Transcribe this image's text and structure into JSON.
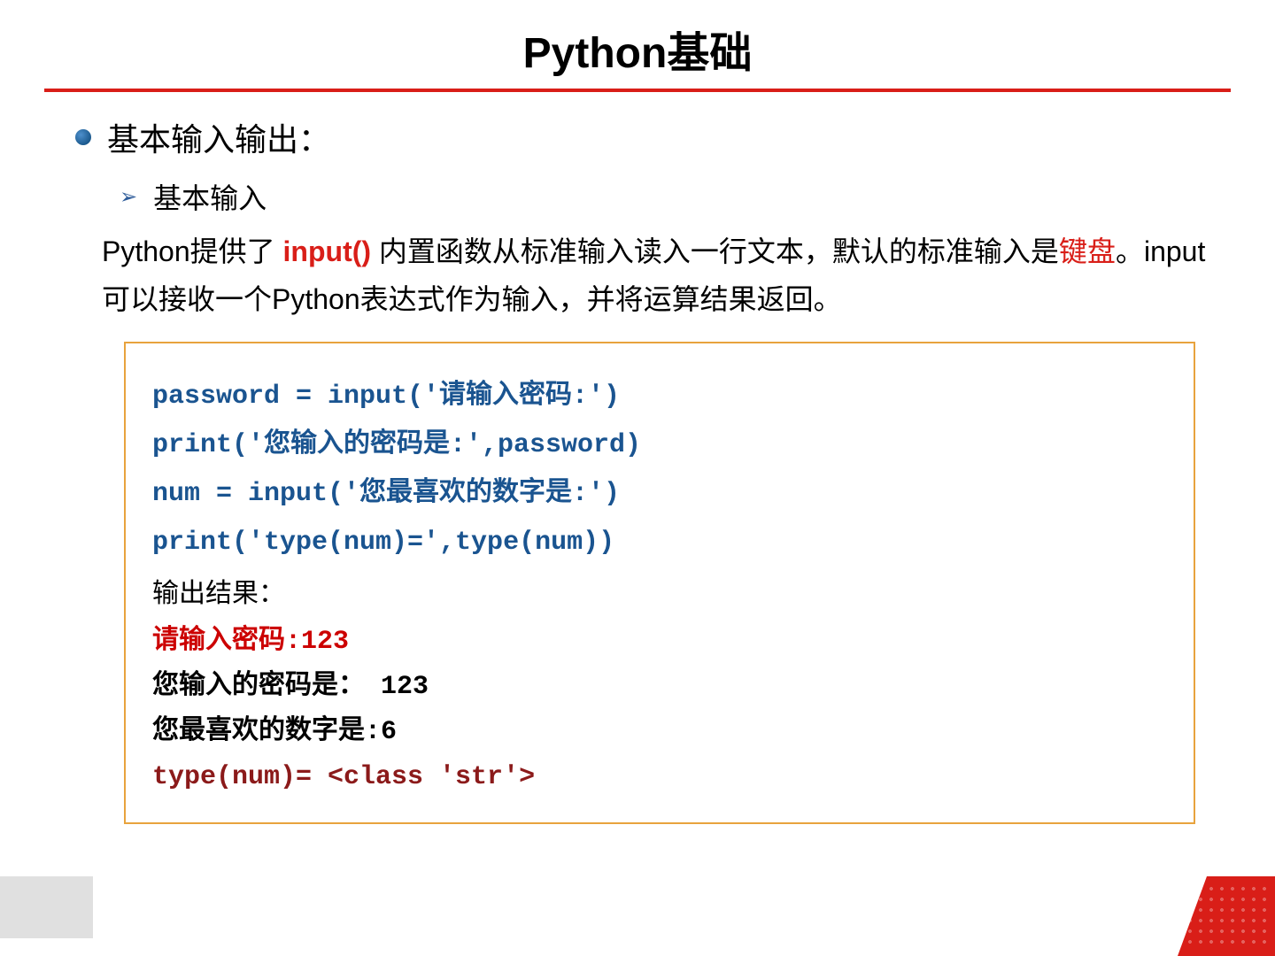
{
  "title": "Python基础",
  "section_heading": "基本输入输出：",
  "sub_heading": "基本输入",
  "paragraph": {
    "prefix": "Python提供了 ",
    "func": "input()",
    "mid1": " 内置函数从标准输入读入一行文本，默认的标准输入是",
    "keyboard": "键盘",
    "mid2": "。input 可以接收一个Python表达式作为输入，并将运算结果返回。"
  },
  "code": {
    "line1": "password = input('请输入密码:')",
    "line2": "print('您输入的密码是:',password)",
    "line3": "num = input('您最喜欢的数字是:')",
    "line4": "print('type(num)=',type(num))",
    "output_label": "输出结果：",
    "out1": "请输入密码:123",
    "out2": "您输入的密码是： 123",
    "out3": "您最喜欢的数字是:6",
    "out4": "type(num)= <class 'str'>"
  }
}
